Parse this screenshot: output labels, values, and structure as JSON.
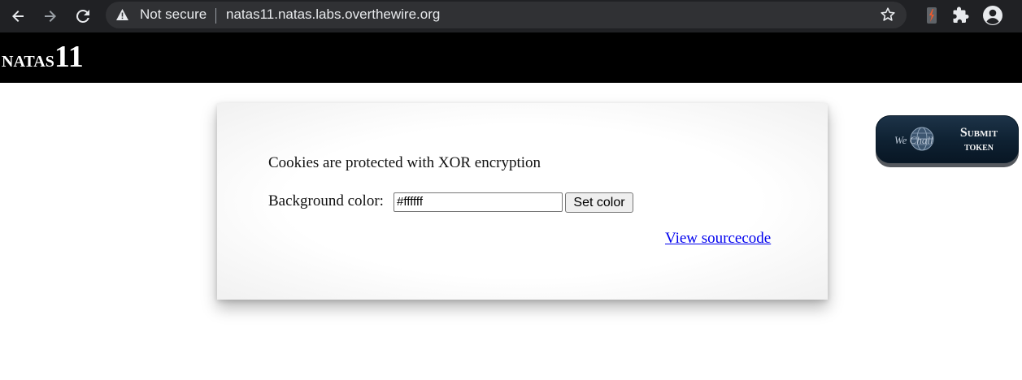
{
  "browser": {
    "security_label": "Not secure",
    "url": "natas11.natas.labs.overthewire.org",
    "icons": [
      "back-arrow-icon",
      "forward-arrow-icon",
      "reload-icon",
      "warning-icon",
      "star-icon",
      "extension-icon",
      "puzzle-icon",
      "profile-icon"
    ]
  },
  "header": {
    "logo_prefix": "natas",
    "logo_number": "11"
  },
  "content": {
    "intro": "Cookies are protected with XOR encryption",
    "bg_label": "Background color:",
    "bg_value": "#ffffff",
    "set_button": "Set color",
    "source_link": "View sourcecode"
  },
  "wechall": {
    "logo_text": "We Chall",
    "line1": "Submit",
    "line2": "token"
  },
  "colors": {
    "chrome_bg": "#202124",
    "omnibox_bg": "#303134",
    "header_bg": "#000000",
    "link": "#0000ee",
    "wechall_bg": "#0f2233"
  }
}
